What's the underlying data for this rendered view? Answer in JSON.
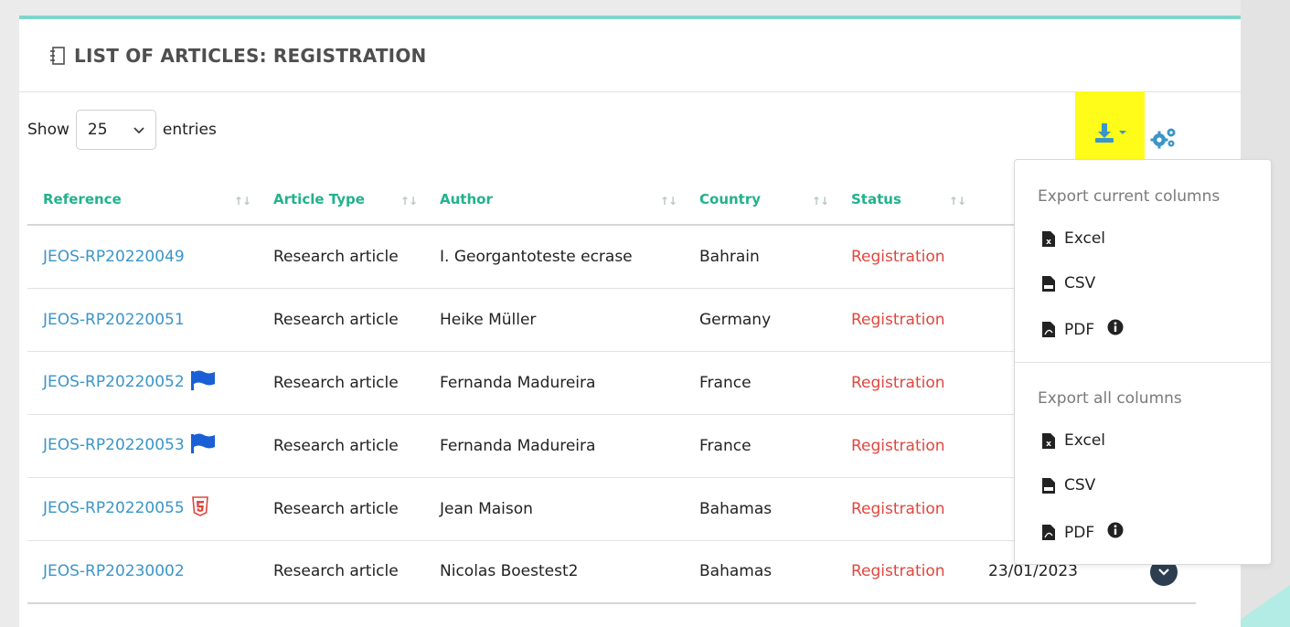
{
  "panel": {
    "title": "LIST OF ARTICLES: REGISTRATION"
  },
  "length_control": {
    "show_label": "Show",
    "selected": "25",
    "entries_label": "entries"
  },
  "columns": [
    "Reference",
    "Article Type",
    "Author",
    "Country",
    "Status"
  ],
  "rows": [
    {
      "reference": "JEOS-RP20220049",
      "article_type": "Research article",
      "author": "I. Georgantoteste ecrase",
      "country": "Bahrain",
      "status": "Registration",
      "marker": ""
    },
    {
      "reference": "JEOS-RP20220051",
      "article_type": "Research article",
      "author": "Heike Müller",
      "country": "Germany",
      "status": "Registration",
      "marker": ""
    },
    {
      "reference": "JEOS-RP20220052",
      "article_type": "Research article",
      "author": "Fernanda Madureira",
      "country": "France",
      "status": "Registration",
      "marker": "flag-icon"
    },
    {
      "reference": "JEOS-RP20220053",
      "article_type": "Research article",
      "author": "Fernanda Madureira",
      "country": "France",
      "status": "Registration",
      "marker": "flag-icon"
    },
    {
      "reference": "JEOS-RP20220055",
      "article_type": "Research article",
      "author": "Jean Maison",
      "country": "Bahamas",
      "status": "Registration",
      "marker": "html5-icon"
    },
    {
      "reference": "JEOS-RP20230002",
      "article_type": "Research article",
      "author": "Nicolas Boestest2",
      "country": "Bahamas",
      "status": "Registration",
      "marker": "",
      "date": "23/01/2023"
    }
  ],
  "export_menu": {
    "current_header": "Export current columns",
    "all_header": "Export all columns",
    "excel": "Excel",
    "csv": "CSV",
    "pdf": "PDF"
  },
  "colors": {
    "accent_teal": "#22b28c",
    "link_blue": "#3b95c9",
    "status_red": "#e0463e",
    "highlight_yellow": "#fffc1a",
    "card_top_border": "#7fd6cb"
  }
}
